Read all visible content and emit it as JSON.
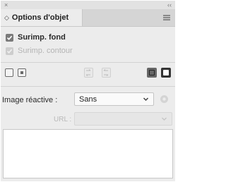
{
  "titlebar": {
    "close_glyph": "×",
    "collapse_glyph": "‹‹"
  },
  "tab": {
    "arrow_glyph": "◇",
    "label": "Options d'objet"
  },
  "checks": {
    "fill": {
      "label": "Surimp. fond",
      "checked": true
    },
    "stroke": {
      "label": "Surimp. contour",
      "checked": false
    }
  },
  "hotspot": {
    "label": "Image réactive :",
    "selected": "Sans"
  },
  "url": {
    "label": "URL :"
  },
  "colors": {
    "panel": "#ececec",
    "tab_bar": "#d5d5d5",
    "check_on": "#7a7a7a"
  }
}
